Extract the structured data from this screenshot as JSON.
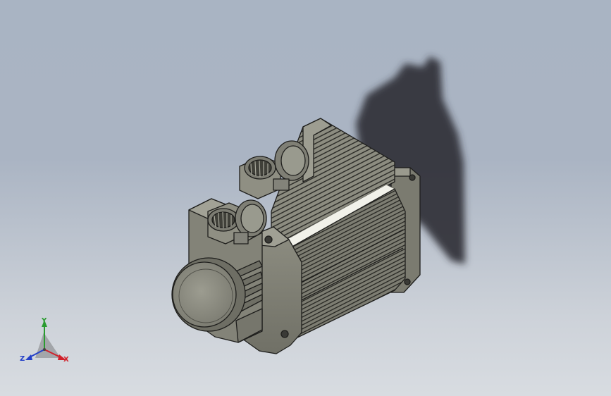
{
  "viewport": {
    "background_top": "#a9b4c3",
    "background_bottom": "#d8dce1"
  },
  "model": {
    "body_color": "#8a8a7e",
    "edge_color": "#1e1e1c",
    "shadow_color": "#2c2f33"
  },
  "triad": {
    "x_label": "X",
    "y_label": "Y",
    "z_label": "Z",
    "x_color": "#d0202a",
    "y_color": "#2a9b30",
    "z_color": "#2440c8"
  }
}
